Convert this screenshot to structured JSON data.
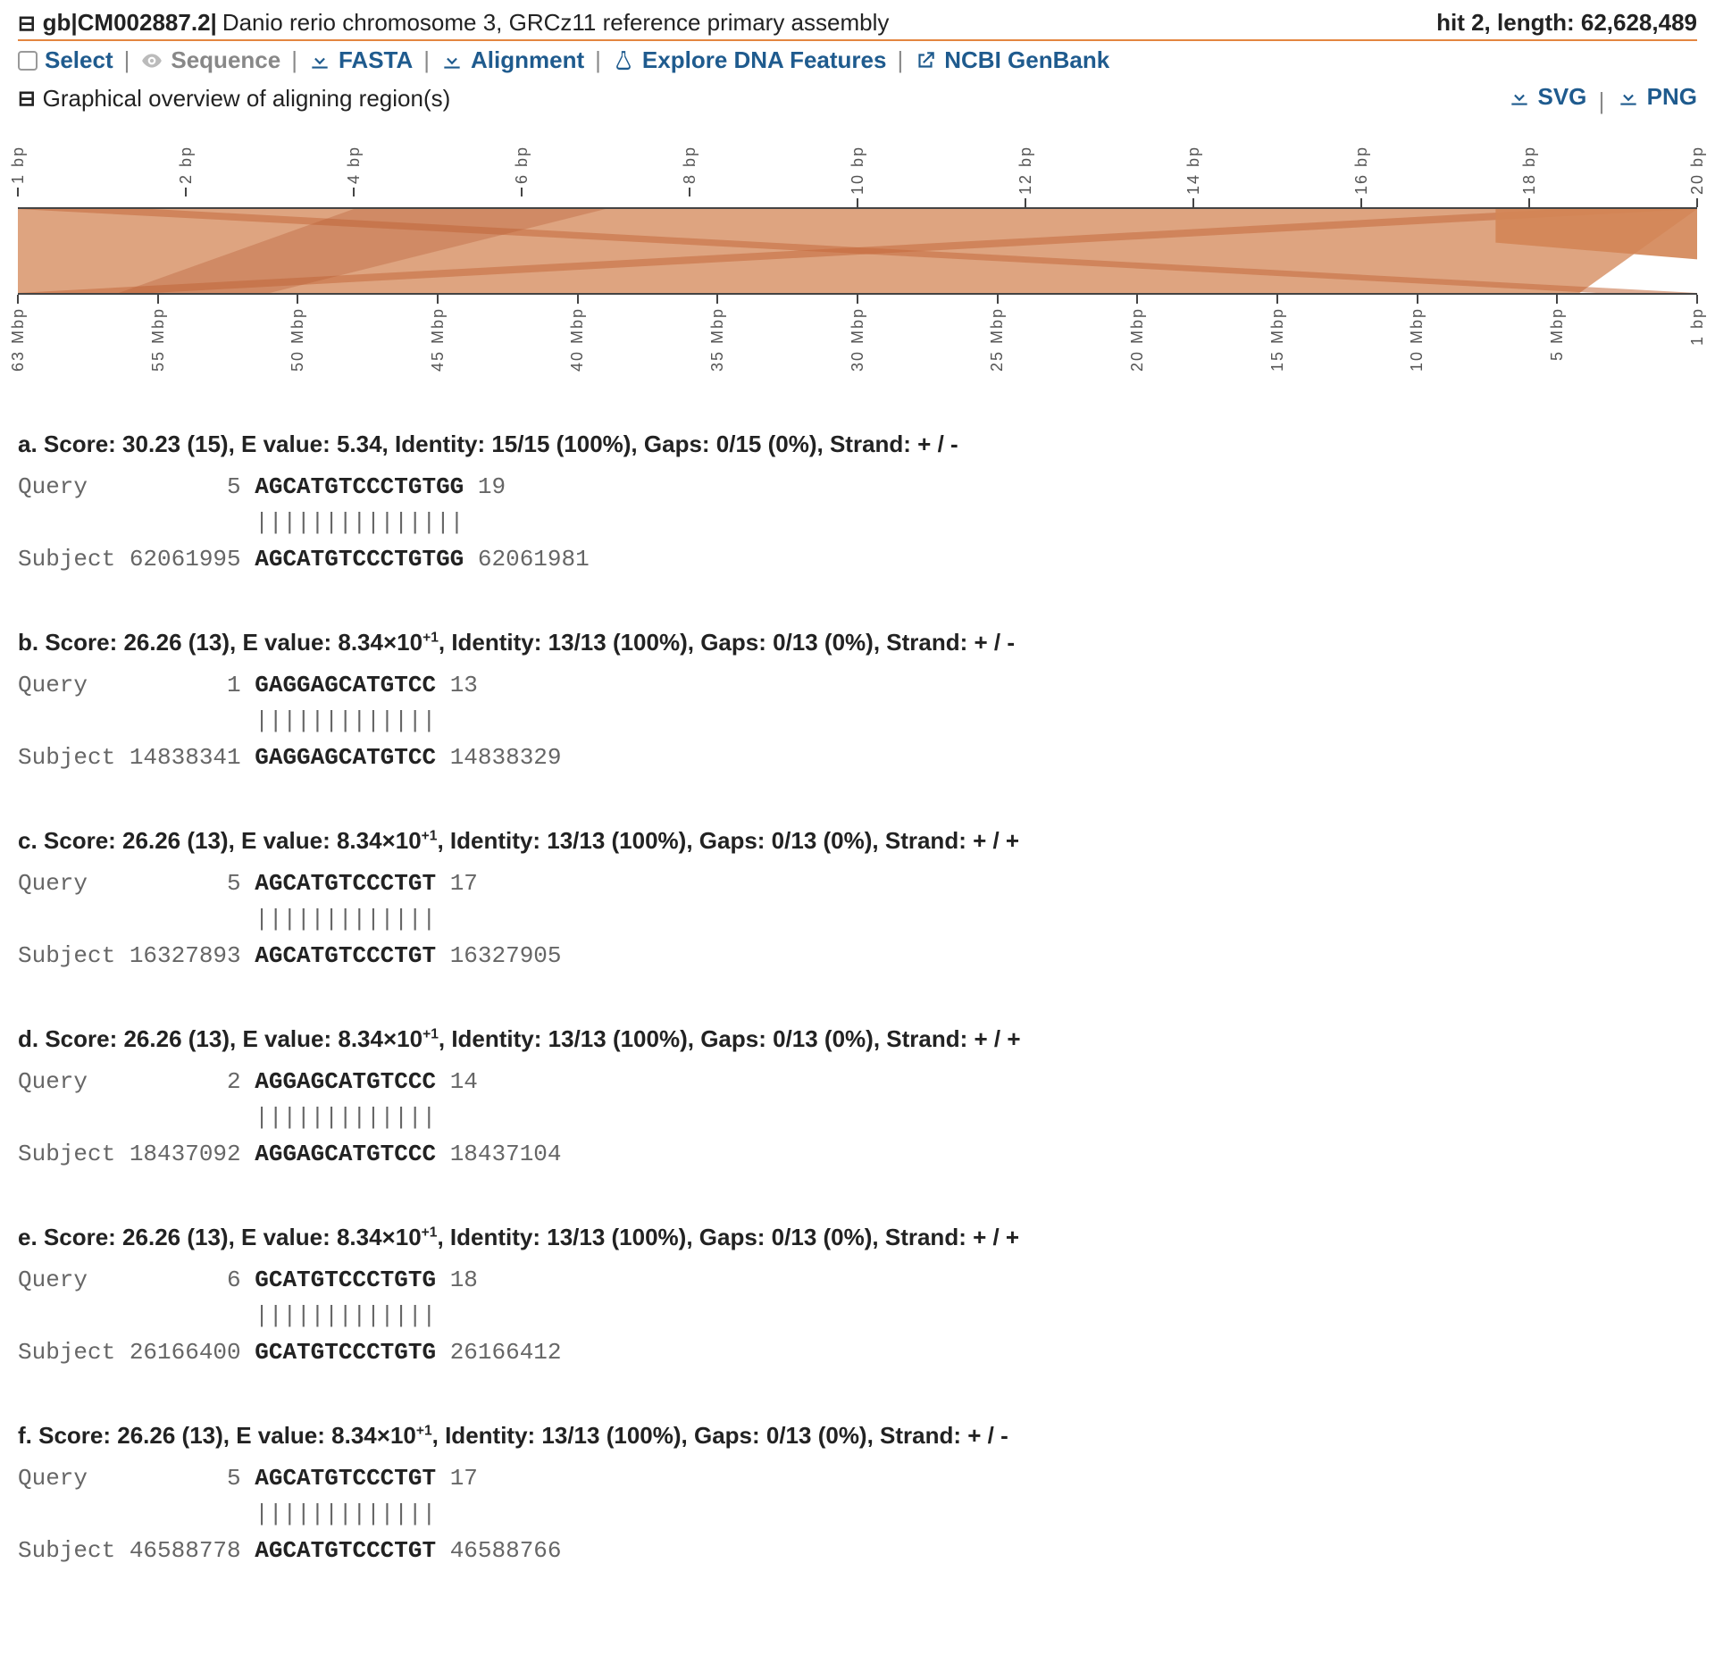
{
  "header": {
    "toggle_glyph": "⊟",
    "accession": "gb|CM002887.2|",
    "description": "Danio rerio chromosome 3, GRCz11 reference primary assembly",
    "hit_label": "hit 2, length: 62,628,489"
  },
  "toolbar": {
    "select": "Select",
    "sequence": "Sequence",
    "fasta": "FASTA",
    "alignment": "Alignment",
    "explore": "Explore DNA Features",
    "genbank": "NCBI GenBank",
    "sep": "|"
  },
  "overview": {
    "toggle_glyph": "⊟",
    "title": "Graphical overview of aligning region(s)",
    "svg": "SVG",
    "png": "PNG"
  },
  "axes": {
    "top": [
      "1 bp",
      "2 bp",
      "4 bp",
      "6 bp",
      "8 bp",
      "10 bp",
      "12 bp",
      "14 bp",
      "16 bp",
      "18 bp",
      "20 bp"
    ],
    "bottom": [
      "63 Mbp",
      "55 Mbp",
      "50 Mbp",
      "45 Mbp",
      "40 Mbp",
      "35 Mbp",
      "30 Mbp",
      "25 Mbp",
      "20 Mbp",
      "15 Mbp",
      "10 Mbp",
      "5 Mbp",
      "1 bp"
    ]
  },
  "alignments": [
    {
      "letter": "a",
      "score": "30.23 (15)",
      "evalue_prefix": "5.34",
      "evalue_exp": "",
      "identity": "15/15 (100%)",
      "gaps": "0/15 (0%)",
      "strand": "+ / -",
      "q_label": "Query",
      "q_start": "5",
      "q_seq": "AGCATGTCCCTGTGG",
      "q_end": "19",
      "match": "|||||||||||||||",
      "s_label": "Subject",
      "s_start": "62061995",
      "s_seq": "AGCATGTCCCTGTGG",
      "s_end": "62061981"
    },
    {
      "letter": "b",
      "score": "26.26 (13)",
      "evalue_prefix": "8.34×10",
      "evalue_exp": "+1",
      "identity": "13/13 (100%)",
      "gaps": "0/13 (0%)",
      "strand": "+ / -",
      "q_label": "Query",
      "q_start": "1",
      "q_seq": "GAGGAGCATGTCC",
      "q_end": "13",
      "match": "|||||||||||||",
      "s_label": "Subject",
      "s_start": "14838341",
      "s_seq": "GAGGAGCATGTCC",
      "s_end": "14838329"
    },
    {
      "letter": "c",
      "score": "26.26 (13)",
      "evalue_prefix": "8.34×10",
      "evalue_exp": "+1",
      "identity": "13/13 (100%)",
      "gaps": "0/13 (0%)",
      "strand": "+ / +",
      "q_label": "Query",
      "q_start": "5",
      "q_seq": "AGCATGTCCCTGT",
      "q_end": "17",
      "match": "|||||||||||||",
      "s_label": "Subject",
      "s_start": "16327893",
      "s_seq": "AGCATGTCCCTGT",
      "s_end": "16327905"
    },
    {
      "letter": "d",
      "score": "26.26 (13)",
      "evalue_prefix": "8.34×10",
      "evalue_exp": "+1",
      "identity": "13/13 (100%)",
      "gaps": "0/13 (0%)",
      "strand": "+ / +",
      "q_label": "Query",
      "q_start": "2",
      "q_seq": "AGGAGCATGTCCC",
      "q_end": "14",
      "match": "|||||||||||||",
      "s_label": "Subject",
      "s_start": "18437092",
      "s_seq": "AGGAGCATGTCCC",
      "s_end": "18437104"
    },
    {
      "letter": "e",
      "score": "26.26 (13)",
      "evalue_prefix": "8.34×10",
      "evalue_exp": "+1",
      "identity": "13/13 (100%)",
      "gaps": "0/13 (0%)",
      "strand": "+ / +",
      "q_label": "Query",
      "q_start": "6",
      "q_seq": "GCATGTCCCTGTG",
      "q_end": "18",
      "match": "|||||||||||||",
      "s_label": "Subject",
      "s_start": "26166400",
      "s_seq": "GCATGTCCCTGTG",
      "s_end": "26166412"
    },
    {
      "letter": "f",
      "score": "26.26 (13)",
      "evalue_prefix": "8.34×10",
      "evalue_exp": "+1",
      "identity": "13/13 (100%)",
      "gaps": "0/13 (0%)",
      "strand": "+ / -",
      "q_label": "Query",
      "q_start": "5",
      "q_seq": "AGCATGTCCCTGT",
      "q_end": "17",
      "match": "|||||||||||||",
      "s_label": "Subject",
      "s_start": "46588778",
      "s_seq": "AGCATGTCCCTGT",
      "s_end": "46588766"
    }
  ]
}
